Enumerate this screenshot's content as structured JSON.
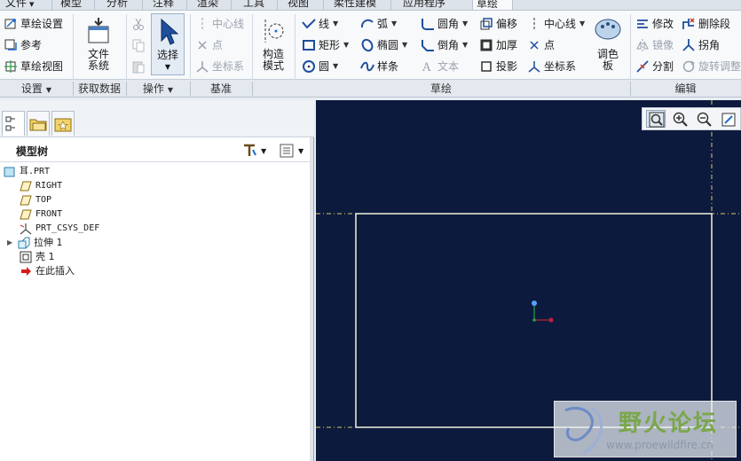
{
  "menubar": {
    "tabs": [
      {
        "label": "文件",
        "dd": "▼"
      },
      {
        "label": "模型"
      },
      {
        "label": "分析"
      },
      {
        "label": "注释"
      },
      {
        "label": "渲染"
      },
      {
        "label": "工具"
      },
      {
        "label": "视图"
      },
      {
        "label": "柔性建模"
      },
      {
        "label": "应用程序"
      },
      {
        "label": "草绘",
        "active": true
      }
    ]
  },
  "ribbon": {
    "setup": {
      "sketch_setup": "草绘设置",
      "references": "参考",
      "sketch_view": "草绘视图",
      "group_label": "设置"
    },
    "get_data": {
      "file_system": [
        "文件",
        "系统"
      ],
      "group_label": "获取数据"
    },
    "operations": {
      "select": "选择",
      "group_label": "操作"
    },
    "datum": {
      "centerline": "中心线",
      "point": "点",
      "coord_sys": "坐标系",
      "group_label": "基准"
    },
    "construction": {
      "label": [
        "构造",
        "模式"
      ]
    },
    "sketch": {
      "line": "线",
      "arc": "弧",
      "fillet": "圆角",
      "offset": "偏移",
      "centerline": "中心线",
      "rectangle": "矩形",
      "ellipse": "椭圆",
      "chamfer": "倒角",
      "thicken": "加厚",
      "point": "点",
      "circle": "圆",
      "spline": "样条",
      "text": "文本",
      "project": "投影",
      "coord_sys": "坐标系",
      "palette": [
        "调色",
        "板"
      ],
      "group_label": "草绘"
    },
    "edit": {
      "modify": "修改",
      "delete_segment": "删除段",
      "mirror": "镜像",
      "corner": "拐角",
      "divide": "分割",
      "rotate_resize": "旋转调整",
      "group_label": "编辑"
    }
  },
  "left_panel": {
    "tree_title": "模型树",
    "items": [
      {
        "label": "耳.PRT",
        "icon": "part-icon",
        "mono": true
      },
      {
        "label": "RIGHT",
        "icon": "datum-plane-icon",
        "mono": true
      },
      {
        "label": "TOP",
        "icon": "datum-plane-icon",
        "mono": true
      },
      {
        "label": "FRONT",
        "icon": "datum-plane-icon",
        "mono": true
      },
      {
        "label": "PRT_CSYS_DEF",
        "icon": "csys-icon",
        "mono": true
      },
      {
        "label": "拉伸 1",
        "icon": "extrude-icon",
        "expandable": true
      },
      {
        "label": "壳 1",
        "icon": "shell-icon"
      },
      {
        "label": "在此插入",
        "icon": "insert-arrow-icon"
      }
    ]
  },
  "watermark": {
    "title": "野火论坛",
    "url": "www.proewildfire.cn"
  },
  "colors": {
    "canvas_bg": "#0c1a3d",
    "sketch_line": "#f2f2dc",
    "reference_dash": "#d7c86a",
    "accent": "#1f6fd1"
  }
}
